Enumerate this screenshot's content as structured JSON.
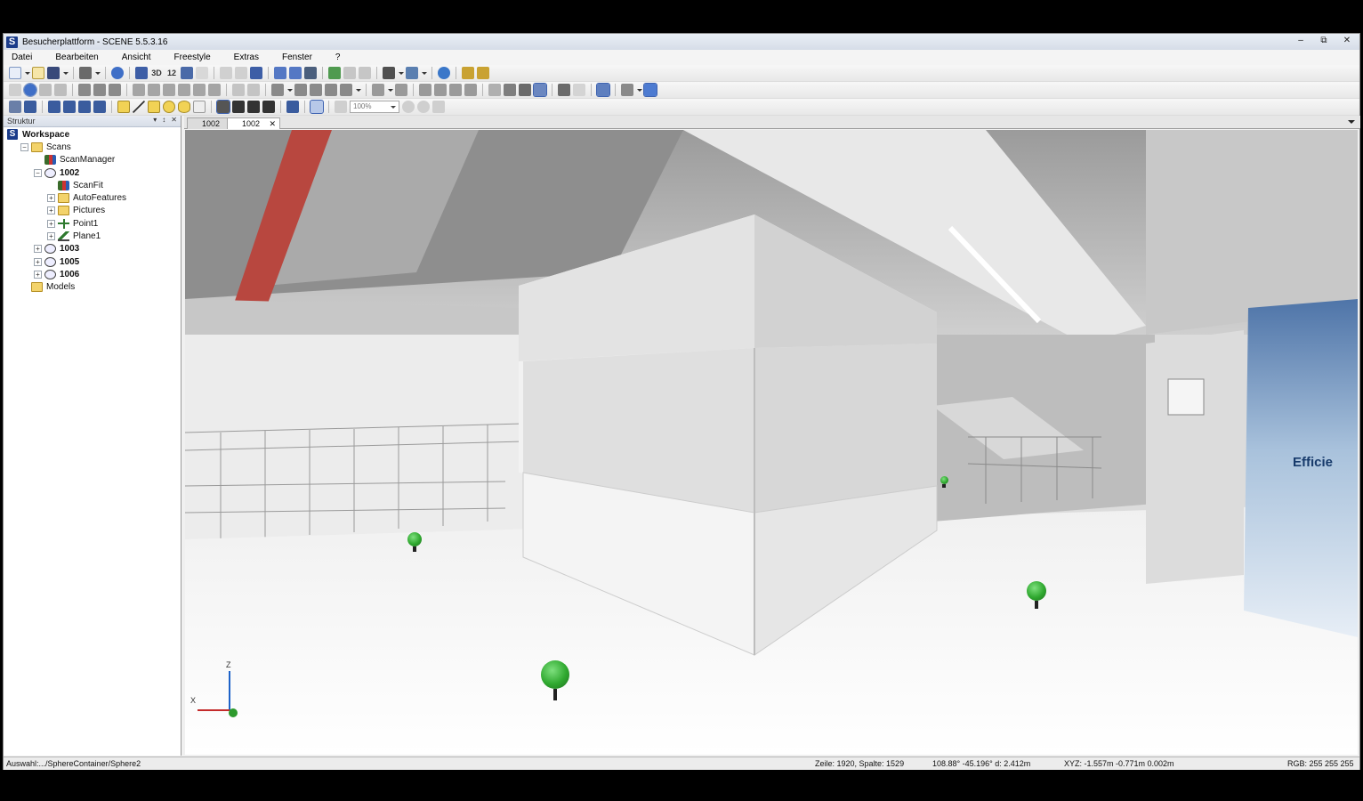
{
  "window": {
    "title": "Besucherplattform - SCENE 5.5.3.16",
    "app_icon_letter": "S",
    "controls": [
      "–",
      "⧉",
      "✕"
    ]
  },
  "menu": [
    "Datei",
    "Bearbeiten",
    "Ansicht",
    "Freestyle",
    "Extras",
    "Fenster",
    "?"
  ],
  "toolbar": {
    "label_3d": "3D",
    "label_12": "12",
    "zoom_placeholder": "100%"
  },
  "panel": {
    "title": "Struktur",
    "controls": [
      "▾",
      "↕",
      "✕"
    ],
    "tree": [
      {
        "label": "Workspace",
        "level": 0,
        "expander": "",
        "icon": "workspace",
        "bold": true
      },
      {
        "label": "Scans",
        "level": 1,
        "expander": "−",
        "icon": "folder",
        "bold": false
      },
      {
        "label": "ScanManager",
        "level": 2,
        "expander": "",
        "icon": "scanmanager",
        "bold": false
      },
      {
        "label": "1002",
        "level": 2,
        "expander": "−",
        "icon": "scan",
        "bold": true
      },
      {
        "label": "ScanFit",
        "level": 3,
        "expander": "",
        "icon": "scanmanager",
        "bold": false
      },
      {
        "label": "AutoFeatures",
        "level": 3,
        "expander": "+",
        "icon": "folder",
        "bold": false
      },
      {
        "label": "Pictures",
        "level": 3,
        "expander": "+",
        "icon": "folder",
        "bold": false
      },
      {
        "label": "Point1",
        "level": 3,
        "expander": "+",
        "icon": "point",
        "bold": false
      },
      {
        "label": "Plane1",
        "level": 3,
        "expander": "+",
        "icon": "plane",
        "bold": false
      },
      {
        "label": "1003",
        "level": 2,
        "expander": "+",
        "icon": "scan",
        "bold": true
      },
      {
        "label": "1005",
        "level": 2,
        "expander": "+",
        "icon": "scan",
        "bold": true
      },
      {
        "label": "1006",
        "level": 2,
        "expander": "+",
        "icon": "scan",
        "bold": true
      },
      {
        "label": "Models",
        "level": 1,
        "expander": "",
        "icon": "folder",
        "bold": false
      }
    ]
  },
  "tabs": [
    {
      "label": "1002",
      "active": false
    },
    {
      "label": "1002",
      "active": true,
      "close": "✕"
    }
  ],
  "viewport": {
    "banner_text": "Efficie",
    "axes": {
      "z": "Z",
      "x": "X"
    },
    "colors": {
      "sphere": "#2fa82f",
      "sphere_dark": "#1f6e1f",
      "ceiling_duct": "#b8473f"
    }
  },
  "status": {
    "selection": "Auswahl:.../SphereContainer/Sphere2",
    "row_col": "Zeile: 1920, Spalte: 1529",
    "angles": "108.88° -45.196°  d: 2.412m",
    "xyz": "XYZ: -1.557m -0.771m 0.002m",
    "rgb": "RGB: 255 255 255"
  }
}
